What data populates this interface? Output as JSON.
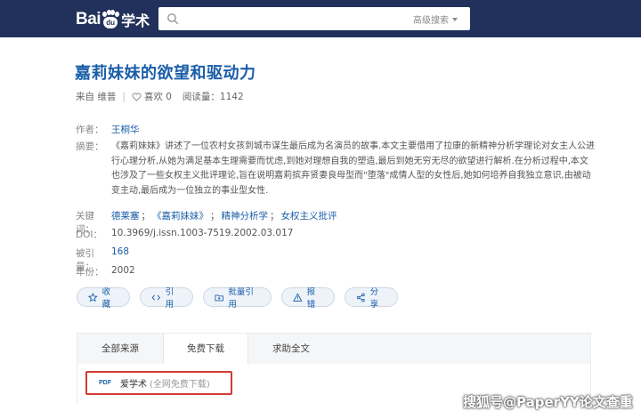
{
  "header": {
    "logo_text": "Bai",
    "logo_paw_text": "du",
    "logo_product": "学术",
    "search_placeholder": "",
    "advanced_search": "高级搜索"
  },
  "paper": {
    "title": "嘉莉妹妹的欲望和驱动力",
    "source": "来自 维普",
    "likes": "喜欢 0",
    "reads": "阅读量：1142"
  },
  "details": {
    "author_label": "作者：",
    "author": "王桐华",
    "abstract_label": "摘要：",
    "abstract": "《嘉莉妹妹》讲述了一位农村女孩到城市谋生最后成为名演员的故事.本文主要借用了拉康的新精神分析学理论对女主人公进行心理分析,从她为满足基本生理需要而忧虑,到她对理想自我的塑造,最后到她无穷无尽的欲望进行解析.在分析过程中,本文也涉及了一些女权主义批评理论,旨在说明嘉莉摈弃贤妻良母型而\"堕落\"成情人型的女性后,她如何培养自我独立意识,由被动变主动,最后成为一位独立的事业型女性.",
    "keywords_label": "关键词：",
    "keywords": [
      "德莱塞",
      "《嘉莉妹妹》",
      "精神分析学",
      "女权主义批评"
    ],
    "keyword_sep": "；",
    "doi_label": "DOI：",
    "doi": "10.3969/j.issn.1003-7519.2002.03.017",
    "cited_label": "被引量：",
    "cited": "168",
    "year_label": "年份：",
    "year": "2002"
  },
  "actions": [
    {
      "label": "收藏",
      "icon": "star-icon"
    },
    {
      "label": "引用",
      "icon": "code-icon"
    },
    {
      "label": "批量引用",
      "icon": "folder-icon"
    },
    {
      "label": "报错",
      "icon": "warning-icon"
    },
    {
      "label": "分享",
      "icon": "share-icon"
    }
  ],
  "sources": {
    "tabs": [
      "全部来源",
      "免费下载",
      "求助全文"
    ],
    "active_tab": 1,
    "item_badge": "PDF",
    "item_name": "爱学术",
    "item_note": "(全网免费下载)"
  },
  "watermark": "搜狐号@PaperYY论文查重",
  "colors": {
    "header_bg": "#22315b",
    "title": "#1b5ea8",
    "link": "#1b5ea8",
    "highlight_border": "#d43a33"
  }
}
